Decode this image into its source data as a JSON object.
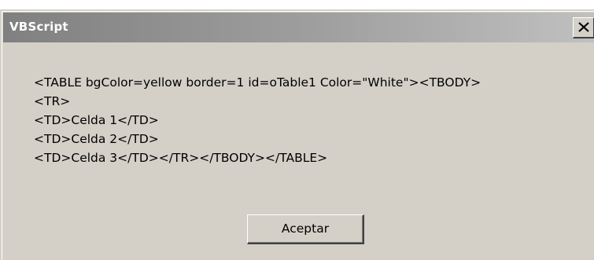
{
  "window": {
    "title": "VBScript"
  },
  "titlebar": {
    "close_icon": "close-icon"
  },
  "message": {
    "lines": [
      "<TABLE bgColor=yellow border=1 id=oTable1 Color=\"White\"><TBODY>",
      "<TR>",
      "<TD>Celda 1</TD>",
      "<TD>Celda 2</TD>",
      "<TD>Celda 3</TD></TR></TBODY></TABLE>"
    ]
  },
  "buttons": {
    "ok_label": "Aceptar"
  },
  "colors": {
    "dialog_face": "#d4d0c8",
    "titlebar_inactive_start": "#808080",
    "titlebar_inactive_end": "#c0c0c0",
    "title_text": "#ffffff"
  }
}
